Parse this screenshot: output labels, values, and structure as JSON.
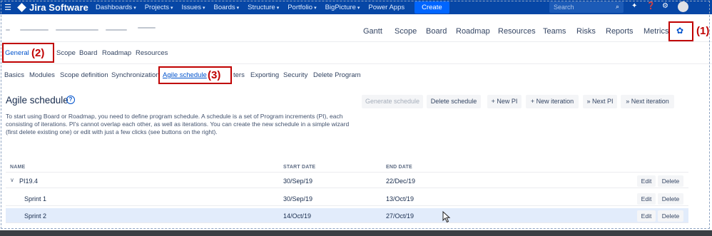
{
  "topbar": {
    "logo_text": "Jira Software",
    "nav": [
      "Dashboards",
      "Projects",
      "Issues",
      "Boards",
      "Structure",
      "Portfolio",
      "BigPicture",
      "Power Apps"
    ],
    "create_label": "Create",
    "search_placeholder": "Search",
    "icons": [
      "menu-icon",
      "search-icon",
      "notifications-icon",
      "help-icon",
      "settings-icon",
      "avatar"
    ]
  },
  "project_nav": [
    "Gantt",
    "Scope",
    "Board",
    "Roadmap",
    "Resources",
    "Teams",
    "Risks",
    "Reports",
    "Metrics"
  ],
  "annotations": [
    "(1)",
    "(2)",
    "(3)"
  ],
  "sub_nav": [
    "General",
    "Scope",
    "Board",
    "Roadmap",
    "Resources"
  ],
  "tabs": [
    "Basics",
    "Modules",
    "Scope definition",
    "Synchronization",
    "Agile schedule",
    "ters",
    "Exporting",
    "Security",
    "Delete Program"
  ],
  "page": {
    "title": "Agile schedule",
    "description": "To start using Board or Roadmap, you need to define program schedule. A schedule is a set of Program increments (PI), each consisting of iterations. PI's cannot overlap each other, as well as iterations. You can create the new schedule in a simple wizard (first delete existing one) or edit with just a few clicks (see buttons on the right).",
    "buttons": {
      "generate": "Generate schedule",
      "delete": "Delete schedule",
      "new_pi": "+ New PI",
      "new_iteration": "+ New iteration",
      "next_pi": "» Next PI",
      "next_iteration": "» Next iteration"
    }
  },
  "table": {
    "headers": [
      "NAME",
      "START DATE",
      "END DATE"
    ],
    "rows": [
      {
        "name": "PI19.4",
        "start": "30/Sep/19",
        "end": "22/Dec/19",
        "edit": "Edit",
        "delete": "Delete"
      },
      {
        "name": "Sprint 1",
        "start": "30/Sep/19",
        "end": "13/Oct/19",
        "edit": "Edit",
        "delete": "Delete"
      },
      {
        "name": "Sprint 2",
        "start": "14/Oct/19",
        "end": "27/Oct/19",
        "edit": "Edit",
        "delete": "Delete"
      }
    ]
  },
  "colors": {
    "topbar": "#0747a6",
    "accent": "#0052cc",
    "annotation": "#c00000",
    "selected_row": "#e2ecfb"
  }
}
